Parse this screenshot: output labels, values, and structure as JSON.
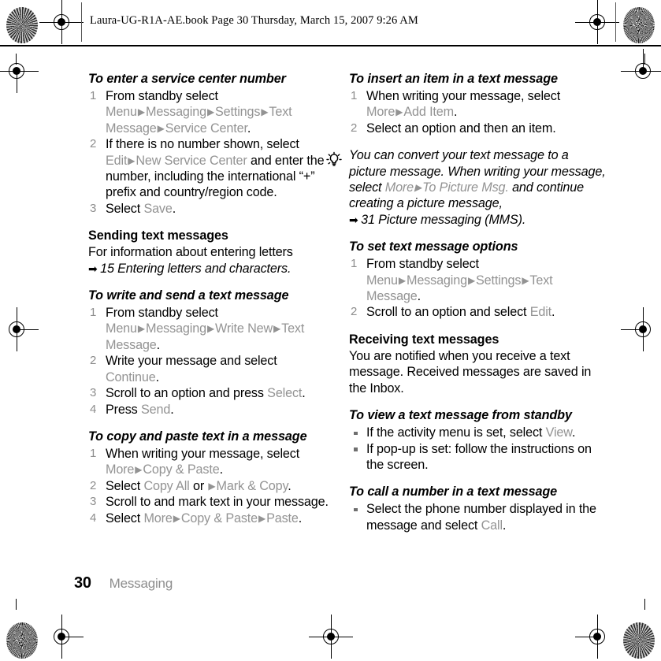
{
  "header": {
    "filestamp": "Laura-UG-R1A-AE.book  Page 30  Thursday, March 15, 2007  9:26 AM"
  },
  "footer": {
    "page_number": "30",
    "running_head": "Messaging"
  },
  "icons": {
    "tip": "lightbulb-icon",
    "cross_reference_arrow": "➡",
    "menu_path_arrow": "▶",
    "registration": "registration-mark-icon",
    "density_patch": "print-density-patch-icon"
  },
  "colors": {
    "ui_term": "#939393",
    "body_text": "#000000",
    "step_number": "#8d8d8d",
    "running_head": "#8d8d8d",
    "bullet": "#6f6f6f"
  },
  "left_column": {
    "section_1": {
      "heading": "To enter a service center number",
      "steps": [
        {
          "parts": [
            {
              "t": "From standby select ",
              "s": "body"
            },
            {
              "t": "Menu",
              "s": "ui"
            },
            {
              "t": "▶",
              "s": "arrow"
            },
            {
              "t": "Messaging",
              "s": "ui"
            },
            {
              "t": "▶",
              "s": "arrow"
            },
            {
              "t": "Settings",
              "s": "ui"
            },
            {
              "t": "▶",
              "s": "arrow"
            },
            {
              "t": "Text Message",
              "s": "ui"
            },
            {
              "t": "▶",
              "s": "arrow"
            },
            {
              "t": "Service Center",
              "s": "ui"
            },
            {
              "t": ".",
              "s": "body"
            }
          ]
        },
        {
          "parts": [
            {
              "t": "If there is no number shown, select ",
              "s": "body"
            },
            {
              "t": "Edit",
              "s": "ui"
            },
            {
              "t": "▶",
              "s": "arrow"
            },
            {
              "t": "New Service Center",
              "s": "ui"
            },
            {
              "t": " and enter the number, including the international “+” prefix and country/region code.",
              "s": "body"
            }
          ]
        },
        {
          "parts": [
            {
              "t": "Select ",
              "s": "body"
            },
            {
              "t": "Save",
              "s": "ui"
            },
            {
              "t": ".",
              "s": "body"
            }
          ]
        }
      ]
    },
    "section_2": {
      "heading": "Sending text messages",
      "paragraph": "For information about entering letters",
      "cross_reference": "15 Entering letters and characters."
    },
    "section_3": {
      "heading": "To write and send a text message",
      "steps": [
        {
          "parts": [
            {
              "t": "From standby select ",
              "s": "body"
            },
            {
              "t": "Menu",
              "s": "ui"
            },
            {
              "t": "▶",
              "s": "arrow"
            },
            {
              "t": "Messaging",
              "s": "ui"
            },
            {
              "t": "▶",
              "s": "arrow"
            },
            {
              "t": "Write New",
              "s": "ui"
            },
            {
              "t": "▶",
              "s": "arrow"
            },
            {
              "t": "Text Message",
              "s": "ui"
            },
            {
              "t": ".",
              "s": "body"
            }
          ]
        },
        {
          "parts": [
            {
              "t": "Write your message and select ",
              "s": "body"
            },
            {
              "t": "Continue",
              "s": "ui"
            },
            {
              "t": ".",
              "s": "body"
            }
          ]
        },
        {
          "parts": [
            {
              "t": "Scroll to an option and press ",
              "s": "body"
            },
            {
              "t": "Select",
              "s": "ui"
            },
            {
              "t": ".",
              "s": "body"
            }
          ]
        },
        {
          "parts": [
            {
              "t": "Press ",
              "s": "body"
            },
            {
              "t": "Send",
              "s": "ui"
            },
            {
              "t": ".",
              "s": "body"
            }
          ]
        }
      ]
    },
    "section_4": {
      "heading": "To copy and paste text in a message",
      "steps": [
        {
          "parts": [
            {
              "t": "When writing your message, select ",
              "s": "body"
            },
            {
              "t": "More",
              "s": "ui"
            },
            {
              "t": "▶",
              "s": "arrow"
            },
            {
              "t": "Copy & Paste",
              "s": "ui"
            },
            {
              "t": ".",
              "s": "body"
            }
          ]
        },
        {
          "parts": [
            {
              "t": "Select ",
              "s": "body"
            },
            {
              "t": "Copy All",
              "s": "ui"
            },
            {
              "t": " or ",
              "s": "body"
            },
            {
              "t": "▶",
              "s": "arrow"
            },
            {
              "t": "Mark & Copy",
              "s": "ui"
            },
            {
              "t": ".",
              "s": "body"
            }
          ]
        },
        {
          "parts": [
            {
              "t": "Scroll to and mark text in your message.",
              "s": "body"
            }
          ]
        },
        {
          "parts": [
            {
              "t": "Select ",
              "s": "body"
            },
            {
              "t": "More",
              "s": "ui"
            },
            {
              "t": "▶",
              "s": "arrow"
            },
            {
              "t": "Copy & Paste",
              "s": "ui"
            },
            {
              "t": "▶",
              "s": "arrow"
            },
            {
              "t": "Paste",
              "s": "ui"
            },
            {
              "t": ".",
              "s": "body"
            }
          ]
        }
      ]
    }
  },
  "right_column": {
    "section_1": {
      "heading": "To insert an item in a text message",
      "steps": [
        {
          "parts": [
            {
              "t": "When writing your message, select ",
              "s": "body"
            },
            {
              "t": "More",
              "s": "ui"
            },
            {
              "t": "▶",
              "s": "arrow"
            },
            {
              "t": "Add Item",
              "s": "ui"
            },
            {
              "t": ".",
              "s": "body"
            }
          ]
        },
        {
          "parts": [
            {
              "t": "Select an option and then an item.",
              "s": "body"
            }
          ]
        }
      ]
    },
    "tip": {
      "parts": [
        {
          "t": "You can convert your text message to a picture message. When writing your message, select ",
          "s": "body"
        },
        {
          "t": "More",
          "s": "ui"
        },
        {
          "t": "▶",
          "s": "arrow"
        },
        {
          "t": "To Picture Msg.",
          "s": "ui"
        },
        {
          "t": " and continue creating a picture message,",
          "s": "body"
        }
      ],
      "cross_reference": "31 Picture messaging (MMS)."
    },
    "section_2": {
      "heading": "To set text message options",
      "steps": [
        {
          "parts": [
            {
              "t": "From standby select ",
              "s": "body"
            },
            {
              "t": "Menu",
              "s": "ui"
            },
            {
              "t": "▶",
              "s": "arrow"
            },
            {
              "t": "Messaging",
              "s": "ui"
            },
            {
              "t": "▶",
              "s": "arrow"
            },
            {
              "t": "Settings",
              "s": "ui"
            },
            {
              "t": "▶",
              "s": "arrow"
            },
            {
              "t": "Text Message",
              "s": "ui"
            },
            {
              "t": ".",
              "s": "body"
            }
          ]
        },
        {
          "parts": [
            {
              "t": "Scroll to an option and select ",
              "s": "body"
            },
            {
              "t": "Edit",
              "s": "ui"
            },
            {
              "t": ".",
              "s": "body"
            }
          ]
        }
      ]
    },
    "section_3": {
      "heading": "Receiving text messages",
      "paragraph": "You are notified when you receive a text message. Received messages are saved in the Inbox."
    },
    "section_4": {
      "heading": "To view a text message from standby",
      "bullets": [
        {
          "parts": [
            {
              "t": "If the activity menu is set, select ",
              "s": "body"
            },
            {
              "t": "View",
              "s": "ui"
            },
            {
              "t": ".",
              "s": "body"
            }
          ]
        },
        {
          "parts": [
            {
              "t": "If pop-up is set: follow the instructions on the screen.",
              "s": "body"
            }
          ]
        }
      ]
    },
    "section_5": {
      "heading": "To call a number in a text message",
      "bullets": [
        {
          "parts": [
            {
              "t": "Select the phone number displayed in the message and select ",
              "s": "body"
            },
            {
              "t": "Call",
              "s": "ui"
            },
            {
              "t": ".",
              "s": "body"
            }
          ]
        }
      ]
    }
  }
}
